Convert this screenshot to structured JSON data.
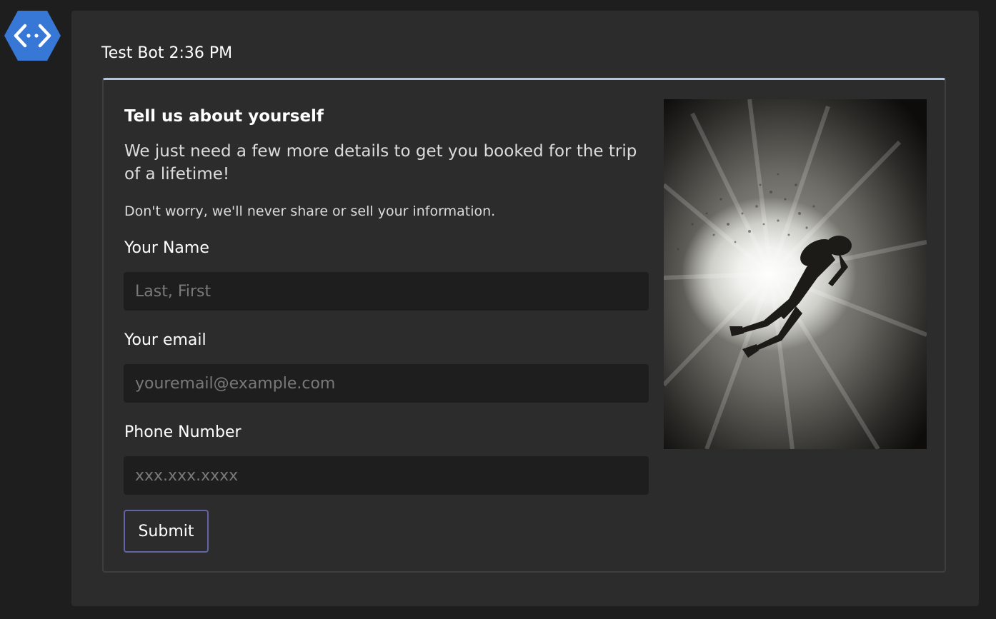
{
  "bot": {
    "avatar_icon": "azure-bot-service-icon",
    "name_time": "Test Bot 2:36 PM"
  },
  "card": {
    "title": "Tell us about yourself",
    "intro": "We just need a few more details to get you booked for the trip of a lifetime!",
    "privacy": "Don't worry, we'll never share or sell your information.",
    "fields": [
      {
        "label": "Your Name",
        "value": "",
        "placeholder": "Last, First"
      },
      {
        "label": "Your email",
        "value": "",
        "placeholder": "youremail@example.com"
      },
      {
        "label": "Phone Number",
        "value": "",
        "placeholder": "xxx.xxx.xxxx"
      }
    ],
    "submit_label": "Submit",
    "image": {
      "description_icon": "scuba-diver-image"
    },
    "accent_color": "#aec6e4",
    "button_border_color": "#6264a7"
  }
}
